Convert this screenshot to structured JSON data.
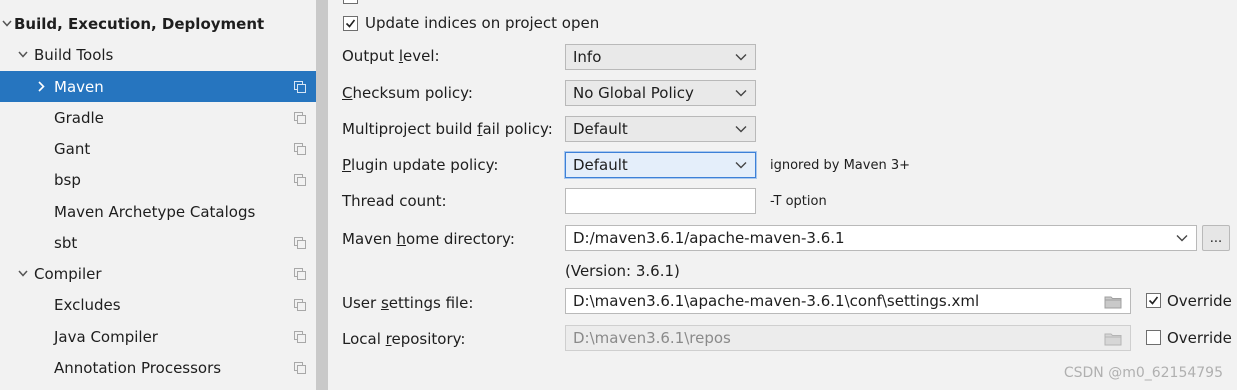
{
  "sidebar": {
    "items": [
      {
        "label": "Build, Execution, Deployment"
      },
      {
        "label": "Build Tools"
      },
      {
        "label": "Maven"
      },
      {
        "label": "Gradle"
      },
      {
        "label": "Gant"
      },
      {
        "label": "bsp"
      },
      {
        "label": "Maven Archetype Catalogs"
      },
      {
        "label": "sbt"
      },
      {
        "label": "Compiler"
      },
      {
        "label": "Excludes"
      },
      {
        "label": "Java Compiler"
      },
      {
        "label": "Annotation Processors"
      }
    ]
  },
  "settings": {
    "update_indices": {
      "label": "Update indices on project open",
      "checked": true
    },
    "output_level": {
      "label_pre": "Output ",
      "label_mn": "l",
      "label_post": "evel:",
      "value": "Info"
    },
    "checksum_policy": {
      "label_pre": "",
      "label_mn": "C",
      "label_post": "hecksum policy:",
      "value": "No Global Policy"
    },
    "multiproject_fail_policy": {
      "label_pre": "Multiproject build ",
      "label_mn": "f",
      "label_post": "ail policy:",
      "value": "Default"
    },
    "plugin_update_policy": {
      "label_pre": "",
      "label_mn": "P",
      "label_post": "lugin update policy:",
      "value": "Default",
      "hint": "ignored by Maven 3+"
    },
    "thread_count": {
      "label": "Thread count:",
      "value": "",
      "hint": "-T option"
    },
    "maven_home": {
      "label_pre": "Maven ",
      "label_mn": "h",
      "label_post": "ome directory:",
      "value": "D:/maven3.6.1/apache-maven-3.6.1",
      "version": "(Version: 3.6.1)",
      "browse_label": "..."
    },
    "user_settings": {
      "label_pre": "User ",
      "label_mn": "s",
      "label_post": "ettings file:",
      "value": "D:\\maven3.6.1\\apache-maven-3.6.1\\conf\\settings.xml",
      "override_label": "Override",
      "override_checked": true
    },
    "local_repo": {
      "label_pre": "Local ",
      "label_mn": "r",
      "label_post": "epository:",
      "value": "D:\\maven3.6.1\\repos",
      "override_label": "Override",
      "override_checked": false
    }
  },
  "watermark": "CSDN @m0_62154795",
  "colors": {
    "selection": "#2675bf",
    "focus": "#3d80d7"
  }
}
